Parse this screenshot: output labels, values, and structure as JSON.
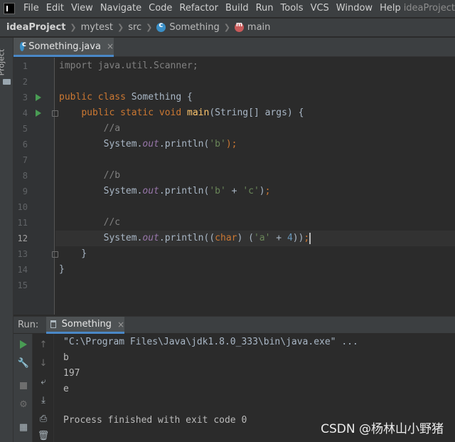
{
  "menubar": {
    "items": [
      "File",
      "Edit",
      "View",
      "Navigate",
      "Code",
      "Refactor",
      "Build",
      "Run",
      "Tools",
      "VCS",
      "Window",
      "Help"
    ],
    "window_title": "ideaProject"
  },
  "breadcrumb": {
    "project": "ideaProject",
    "module": "mytest",
    "src": "src",
    "class": "Something",
    "method": "main"
  },
  "sidebar": {
    "project_tab": "Project"
  },
  "editor_tab": {
    "label": "Something.java",
    "close": "×"
  },
  "editor": {
    "line_numbers": [
      "1",
      "2",
      "3",
      "4",
      "5",
      "6",
      "7",
      "8",
      "9",
      "10",
      "11",
      "12",
      "13",
      "14",
      "15"
    ],
    "current_line": "12"
  },
  "run_panel": {
    "label": "Run:",
    "tab_label": "Something",
    "close": "×",
    "output": [
      "\"C:\\Program Files\\Java\\jdk1.8.0_333\\bin\\java.exe\" ...",
      "b",
      "197",
      "e",
      "",
      "Process finished with exit code 0"
    ]
  },
  "watermark": "CSDN @杨林山小野猪",
  "colors": {
    "background": "#2b2b2b",
    "keyword": "#cc7832",
    "string": "#6a8759",
    "number": "#6897bb",
    "comment": "#808080",
    "method": "#ffc66d",
    "static_field": "#9876aa",
    "accent": "#4a88c7",
    "run_green": "#499c54"
  }
}
